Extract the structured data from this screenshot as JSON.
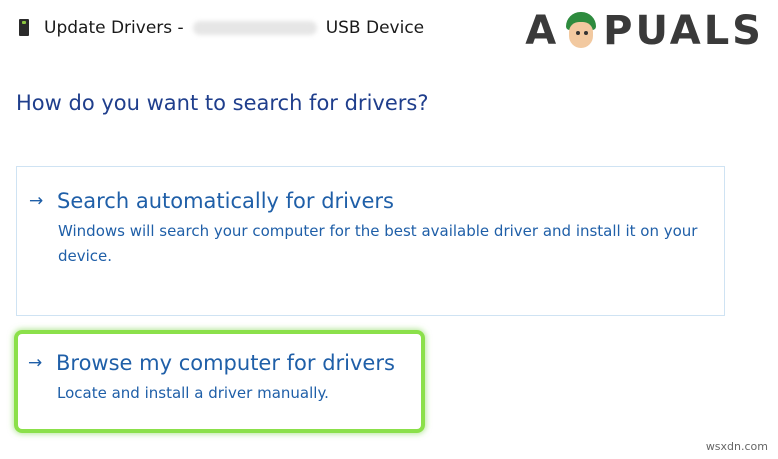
{
  "window": {
    "title_prefix": "Update Drivers -",
    "title_suffix": "USB Device",
    "icon": "usb-drive-icon"
  },
  "logo": {
    "left_text": "A",
    "right_text": "PUALS",
    "icon": "mascot-face-icon"
  },
  "main": {
    "heading": "How do you want to search for drivers?",
    "options": [
      {
        "icon": "arrow-right-icon",
        "arrow": "→",
        "title": "Search automatically for drivers",
        "description": "Windows will search your computer for the best available driver and install it on your device."
      },
      {
        "icon": "arrow-right-icon",
        "arrow": "→",
        "title": "Browse my computer for drivers",
        "description": "Locate and install a driver manually.",
        "highlight_color": "#8be04a"
      }
    ]
  },
  "source_watermark": "wsxdn.com",
  "colors": {
    "heading": "#1f3e8c",
    "link": "#1f5fa8",
    "option_border": "#cfe3f3",
    "highlight": "#8be04a"
  }
}
